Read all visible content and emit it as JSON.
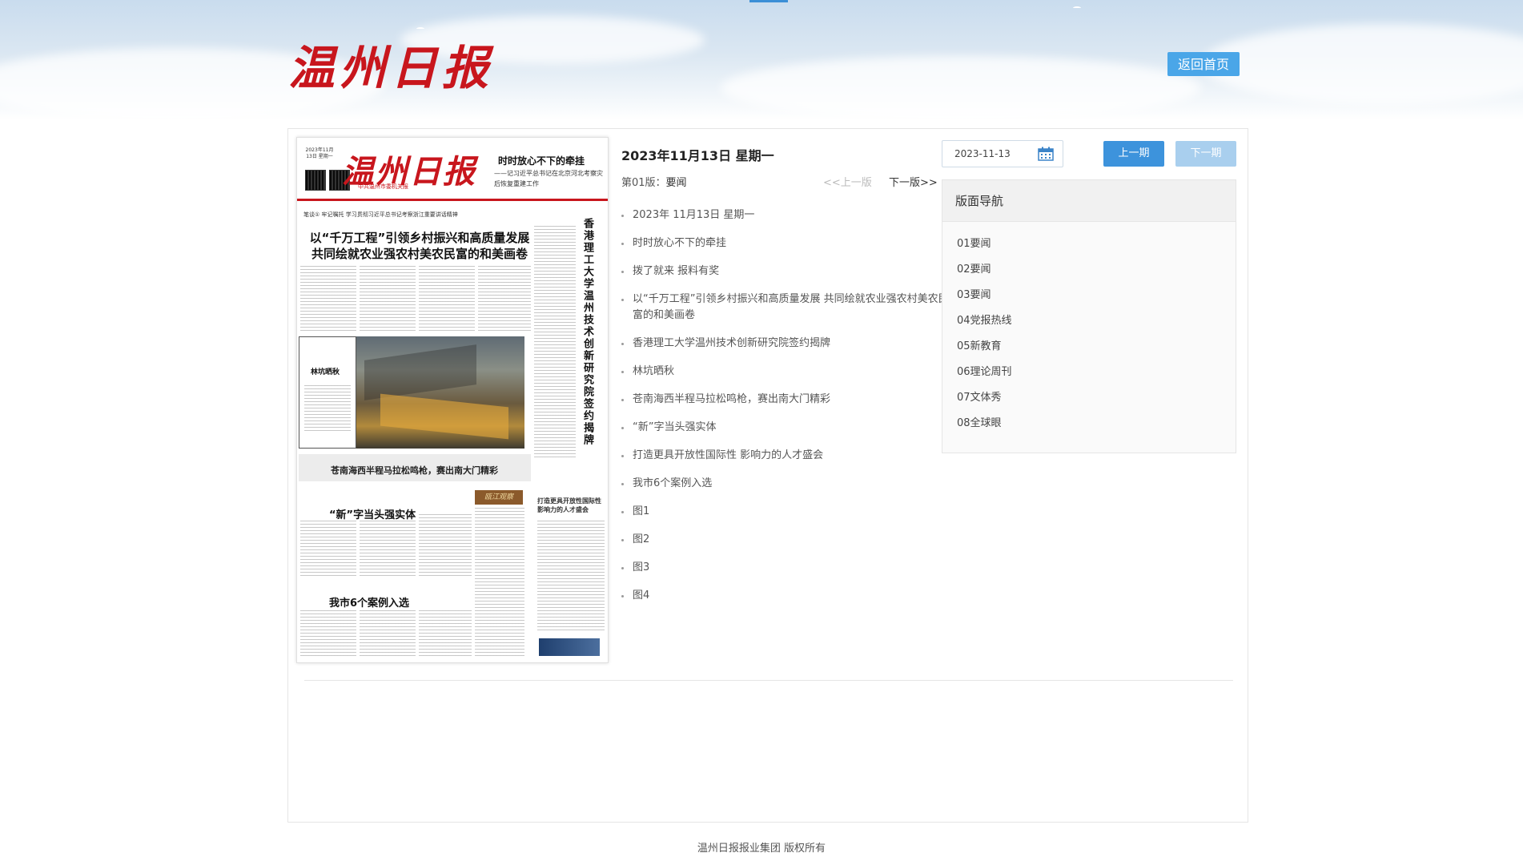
{
  "header": {
    "logo_text": "温州日报",
    "home_button": "返回首页"
  },
  "newspaper_page": {
    "masthead_logo": "温州日报",
    "masthead_date": "2023年11月13日 星期一",
    "masthead_sub": "中共温州市委机关报",
    "top_right_headline": "时时放心不下的牵挂",
    "top_right_sub": "——记习近平总书记在北京河北考察灾后恢复重建工作",
    "kicker": "笔谈① 牢记嘱托 学习贯彻习近平总书记考察浙江重要讲话精神",
    "main_headline": "以“千万工程”引领乡村振兴和高质量发展 共同绘就农业强农村美农民富的和美画卷",
    "vertical_headline": "香港理工大学温州技术创新研究院签约揭牌",
    "box_label": "林坑晒秋",
    "banner_headline": "苍南海西半程马拉松鸣枪，赛出南大门精彩",
    "story_headline_1": "“新”字当头强实体",
    "story_headline_2": "我市6个案例入选",
    "story_headline_3": "打造更具开放性国际性影响力的人才盛会",
    "tag_text": "瓯江观察"
  },
  "issue": {
    "date_title": "2023年11月13日 星期一",
    "edition_label": "第01版：",
    "edition_name": "要闻",
    "prev_page": "<<上一版",
    "next_page": "下一版>>"
  },
  "articles": [
    "2023年 11月13日 星期一",
    "时时放心不下的牵挂",
    "拨了就来 报料有奖",
    "以“千万工程”引领乡村振兴和高质量发展 共同绘就农业强农村美农民富的和美画卷",
    "香港理工大学温州技术创新研究院签约揭牌",
    "林坑晒秋",
    "苍南海西半程马拉松鸣枪，赛出南大门精彩",
    "“新”字当头强实体",
    "打造更具开放性国际性 影响力的人才盛会",
    "我市6个案例入选",
    "图1",
    "图2",
    "图3",
    "图4"
  ],
  "date_picker": {
    "value": "2023-11-13",
    "prev_issue": "上一期",
    "next_issue": "下一期"
  },
  "nav": {
    "title": "版面导航",
    "items": [
      "01要闻",
      "02要闻",
      "03要闻",
      "04党报热线",
      "05新教育",
      "06理论周刊",
      "07文体秀",
      "08全球眼"
    ]
  },
  "footer": {
    "copyright": "温州日报报业集团 版权所有"
  },
  "colors": {
    "brand_red": "#c8161d",
    "button_blue": "#3d93dc",
    "button_disabled": "#a9cfee"
  }
}
